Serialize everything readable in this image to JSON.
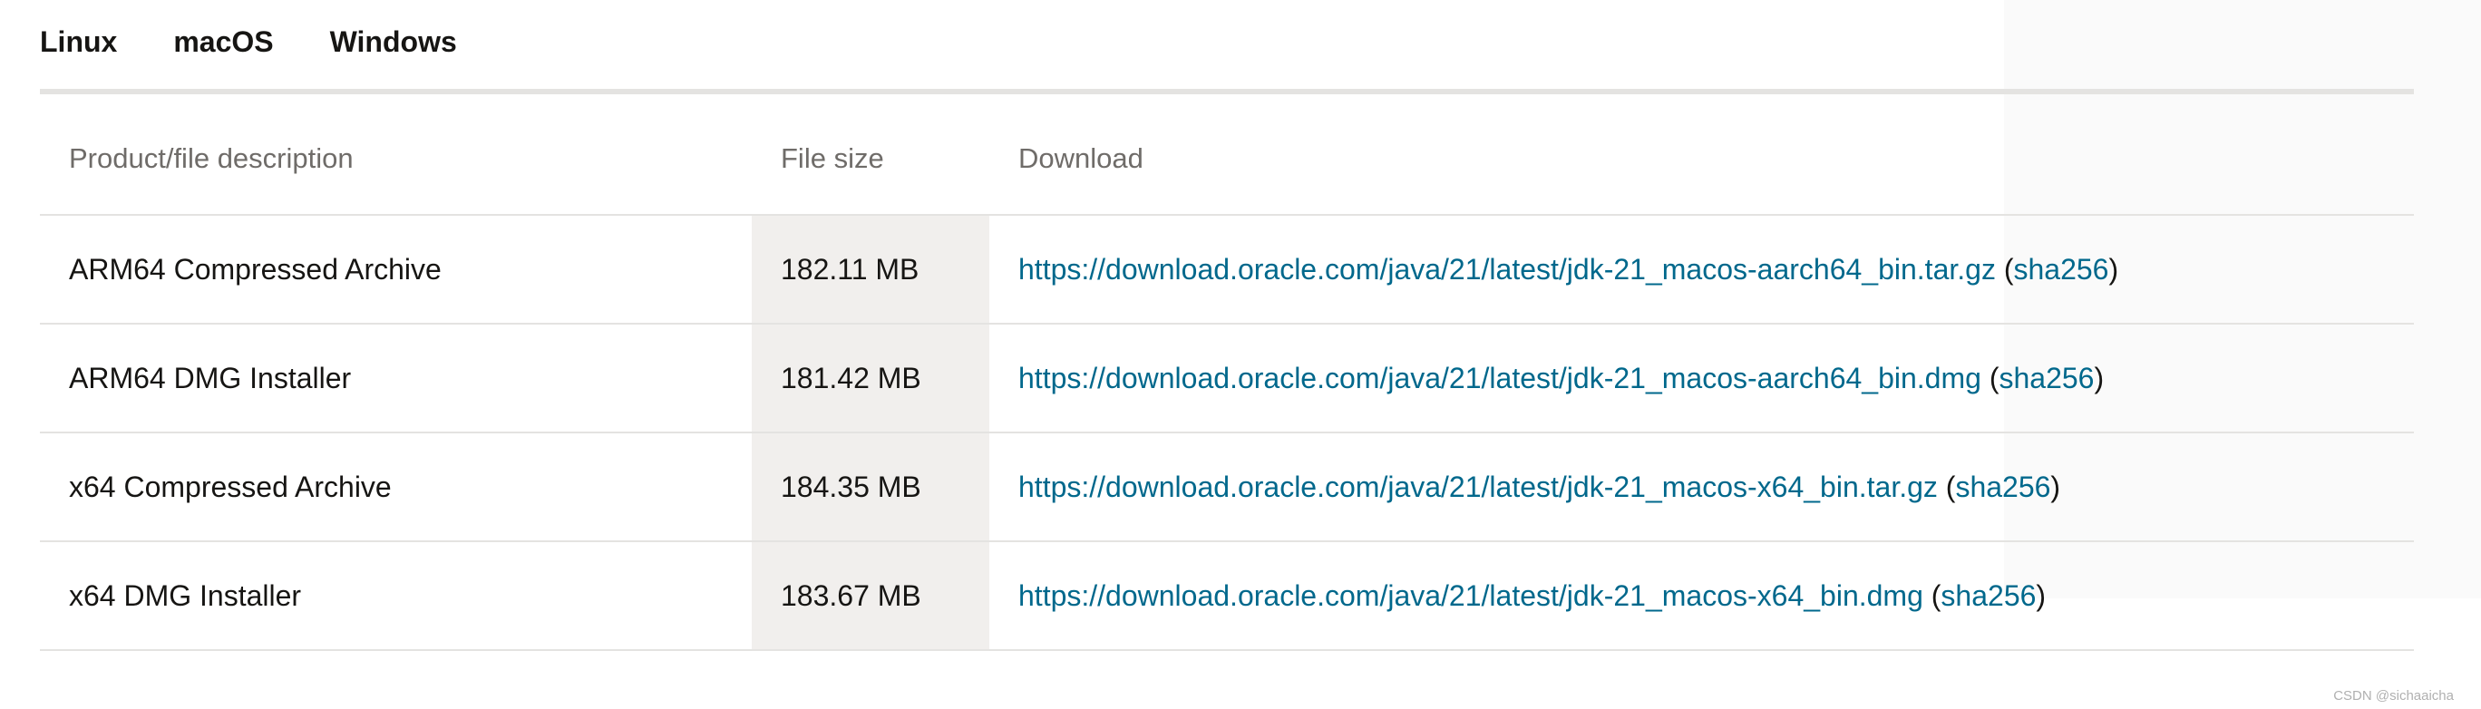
{
  "tabs": [
    {
      "label": "Linux",
      "active": false
    },
    {
      "label": "macOS",
      "active": true
    },
    {
      "label": "Windows",
      "active": false
    }
  ],
  "accent_color": "#4e7a3e",
  "link_color": "#00688c",
  "table": {
    "headers": [
      "Product/file description",
      "File size",
      "Download"
    ],
    "rows": [
      {
        "description": "ARM64 Compressed Archive",
        "size": "182.11 MB",
        "url": "https://download.oracle.com/java/21/latest/jdk-21_macos-aarch64_bin.tar.gz",
        "checksum": "sha256"
      },
      {
        "description": "ARM64 DMG Installer",
        "size": "181.42 MB",
        "url": "https://download.oracle.com/java/21/latest/jdk-21_macos-aarch64_bin.dmg",
        "checksum": "sha256"
      },
      {
        "description": "x64 Compressed Archive",
        "size": "184.35 MB",
        "url": "https://download.oracle.com/java/21/latest/jdk-21_macos-x64_bin.tar.gz",
        "checksum": "sha256"
      },
      {
        "description": "x64 DMG Installer",
        "size": "183.67 MB",
        "url": "https://download.oracle.com/java/21/latest/jdk-21_macos-x64_bin.dmg",
        "checksum": "sha256"
      }
    ]
  },
  "watermark": "CSDN @sichaaicha"
}
